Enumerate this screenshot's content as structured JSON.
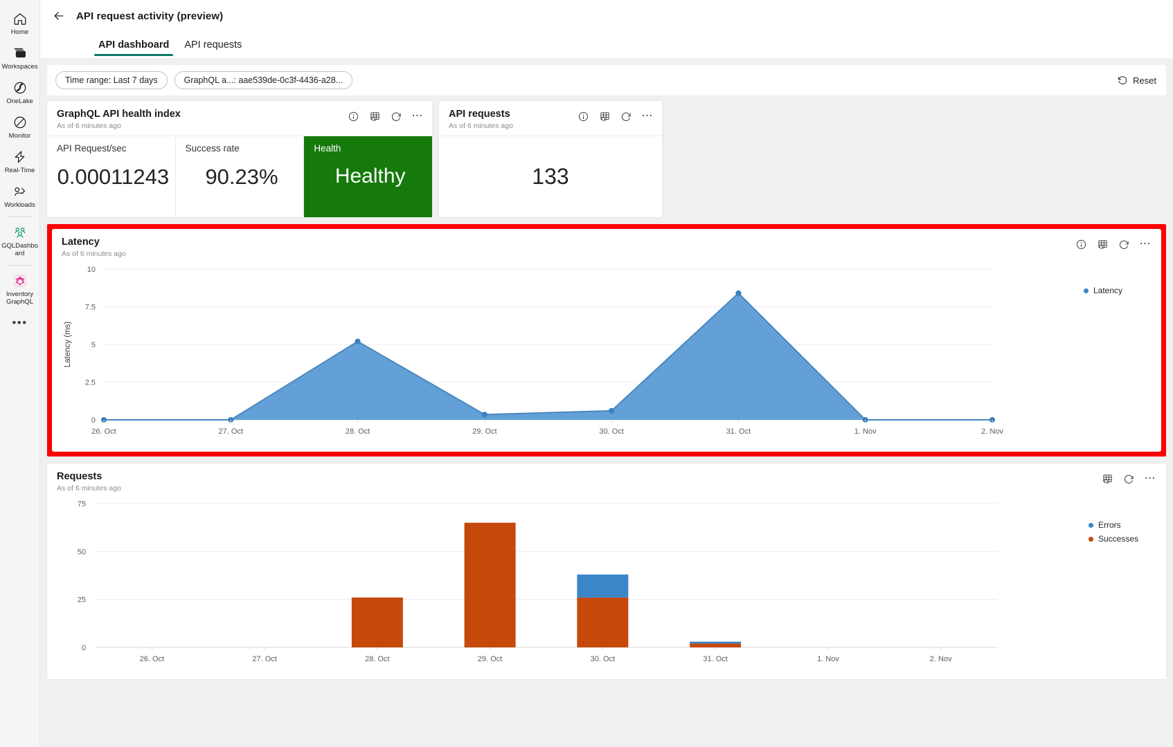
{
  "rail": {
    "items": [
      {
        "label": "Home",
        "icon": "home-icon"
      },
      {
        "label": "Workspaces",
        "icon": "workspaces-icon"
      },
      {
        "label": "OneLake",
        "icon": "onelake-icon"
      },
      {
        "label": "Monitor",
        "icon": "monitor-icon"
      },
      {
        "label": "Real-Time",
        "icon": "real-time-icon"
      },
      {
        "label": "Workloads",
        "icon": "workloads-icon"
      },
      {
        "label": "GQLDashboard",
        "icon": "gql-dashboard-icon"
      },
      {
        "label": "Inventory GraphQL",
        "icon": "inventory-graphql-icon"
      }
    ],
    "more": "•••"
  },
  "header": {
    "back": "back-arrow",
    "title": "API request activity (preview)",
    "tabs": [
      {
        "label": "API dashboard",
        "active": true
      },
      {
        "label": "API requests",
        "active": false
      }
    ]
  },
  "filters": {
    "pills": [
      "Time range: Last 7 days",
      "GraphQL a...: aae539de-0c3f-4436-a28..."
    ],
    "reset_label": "Reset",
    "reset_icon": "refresh-ccw-icon"
  },
  "tiles": {
    "health": {
      "title": "GraphQL API health index",
      "subtitle": "As of 6 minutes ago",
      "actions": [
        "info-icon",
        "table-icon",
        "refresh-icon",
        "more-icon"
      ],
      "kpis": [
        {
          "label": "API Request/sec",
          "value": "0.00011243",
          "accent": false
        },
        {
          "label": "Success rate",
          "value": "90.23%",
          "accent": false
        },
        {
          "label": "Health",
          "value": "Healthy",
          "accent": true
        }
      ],
      "accent_color": "#157a0b"
    },
    "requests": {
      "title": "API requests",
      "subtitle": "As of 6 minutes ago",
      "actions": [
        "info-icon",
        "table-icon",
        "refresh-icon",
        "more-icon"
      ],
      "value": "133"
    }
  },
  "latency_card": {
    "title": "Latency",
    "subtitle": "As of 6 minutes ago",
    "actions": [
      "info-icon",
      "table-icon",
      "refresh-icon",
      "more-icon"
    ],
    "highlighted": true,
    "highlight_color": "#fe0000"
  },
  "requests_card": {
    "title": "Requests",
    "subtitle": "As of 6 minutes ago",
    "actions": [
      "table-icon",
      "refresh-icon",
      "more-icon"
    ]
  },
  "chart_data": [
    {
      "id": "latency",
      "type": "area",
      "title": "Latency",
      "xlabel": "",
      "ylabel": "Latency (ms)",
      "categories": [
        "26. Oct",
        "27. Oct",
        "28. Oct",
        "29. Oct",
        "30. Oct",
        "31. Oct",
        "1. Nov",
        "2. Nov"
      ],
      "series": [
        {
          "name": "Latency",
          "color": "#5b9bd5",
          "values": [
            0,
            0,
            5.2,
            0.35,
            0.6,
            8.4,
            0,
            0
          ]
        }
      ],
      "yticks": [
        0,
        2.5,
        5,
        7.5,
        10
      ],
      "ylim": [
        0,
        10
      ],
      "grid": true,
      "legend": [
        "Latency"
      ],
      "legend_position": "right"
    },
    {
      "id": "requests",
      "type": "bar",
      "title": "Requests",
      "stacked": true,
      "xlabel": "",
      "ylabel": "",
      "categories": [
        "26. Oct",
        "27. Oct",
        "28. Oct",
        "29. Oct",
        "30. Oct",
        "31. Oct",
        "1. Nov",
        "2. Nov"
      ],
      "series": [
        {
          "name": "Successes",
          "color": "#c5490b",
          "values": [
            0,
            0,
            26,
            65,
            26,
            2,
            0,
            0
          ]
        },
        {
          "name": "Errors",
          "color": "#3a86c8",
          "values": [
            0,
            0,
            0,
            0,
            12,
            1,
            0,
            0
          ]
        }
      ],
      "yticks": [
        0,
        25,
        50,
        75
      ],
      "ylim": [
        0,
        75
      ],
      "grid": true,
      "legend": [
        "Errors",
        "Successes"
      ],
      "legend_position": "right"
    }
  ]
}
